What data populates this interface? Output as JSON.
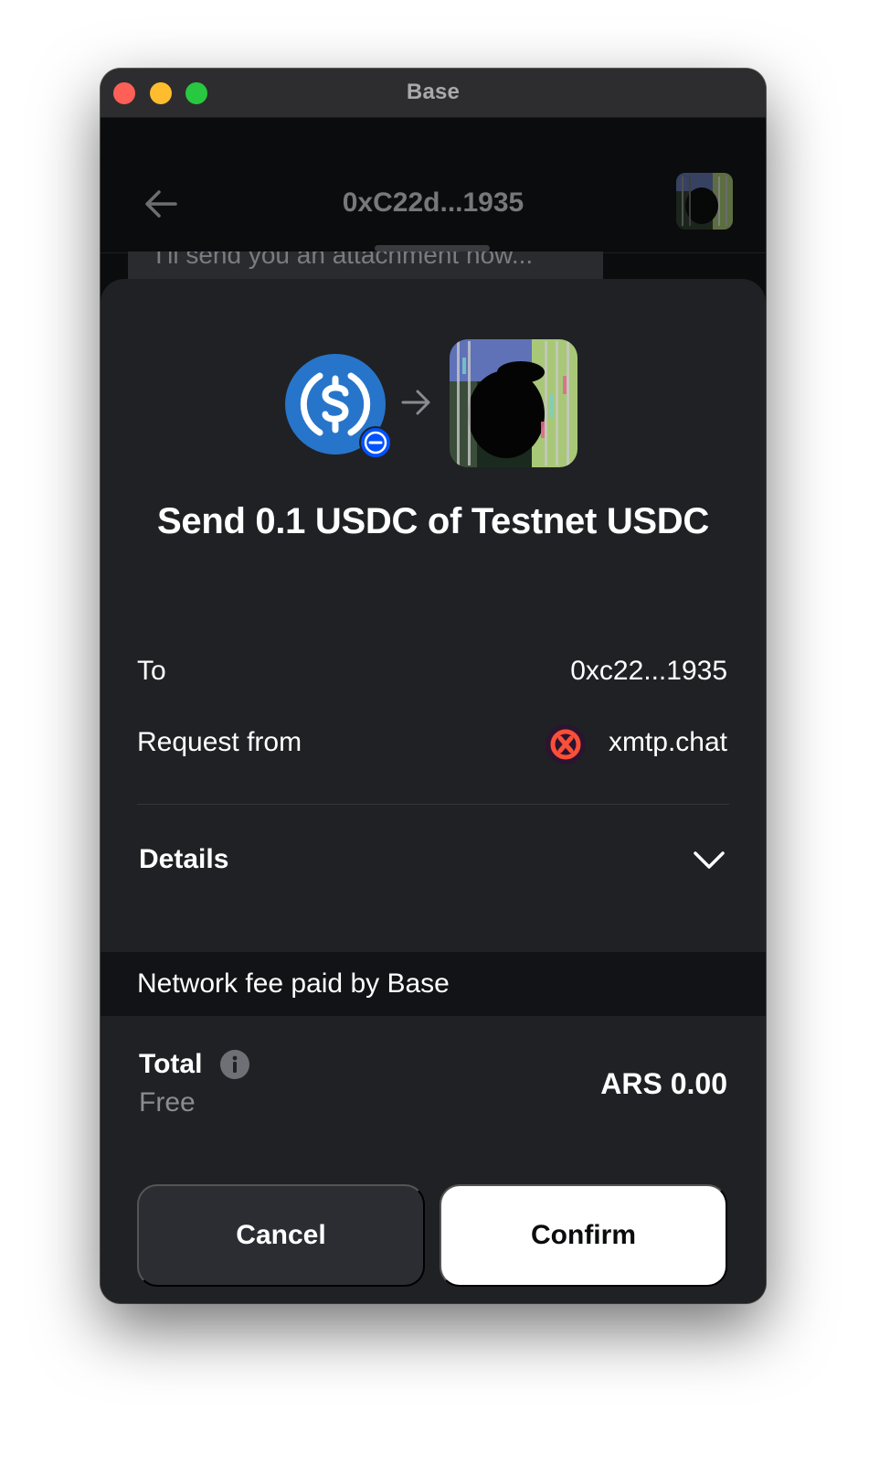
{
  "window": {
    "title": "Base"
  },
  "chat": {
    "title": "0xC22d...1935",
    "last_message": "I'll send you an attachment now..."
  },
  "sheet": {
    "headline": "Send 0.1 USDC of Testnet USDC",
    "token_icon": "usdc-icon",
    "rows": {
      "to_label": "To",
      "to_value": "0xc22...1935",
      "request_label": "Request from",
      "request_value": "xmtp.chat"
    },
    "details_label": "Details",
    "fee_text": "Network fee paid by Base",
    "total_label": "Total",
    "total_sub": "Free",
    "total_value": "ARS 0.00",
    "cancel_label": "Cancel",
    "confirm_label": "Confirm"
  },
  "colors": {
    "usdc_blue": "#2775ca",
    "xmtp_red": "#fc4f37",
    "badge_blue": "#0052ff"
  }
}
